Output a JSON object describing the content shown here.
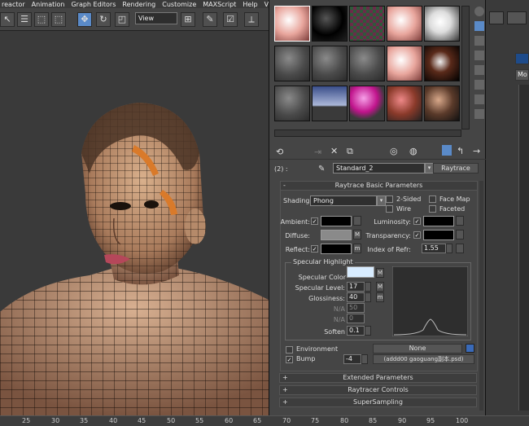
{
  "menu": [
    "reactor",
    "Animation",
    "Graph Editors",
    "Rendering",
    "Customize",
    "MAXScript",
    "Help",
    "Vue"
  ],
  "toolbar": {
    "view_select": "View"
  },
  "material_editor": {
    "level": "(2) :",
    "material_name": "Standard_2",
    "material_type": "Raytrace",
    "rollout_title": "Raytrace Basic Parameters",
    "shading_label": "Shading:",
    "shading_value": "Phong",
    "two_sided": "2-Sided",
    "wire": "Wire",
    "face_map": "Face Map",
    "faceted": "Faceted",
    "ambient": "Ambient:",
    "diffuse": "Diffuse:",
    "reflect": "Reflect:",
    "luminosity": "Luminosity:",
    "transparency": "Transparency:",
    "ior_label": "Index of Refr:",
    "ior_value": "1.55",
    "m": "M",
    "m_lower": "m",
    "specular_group": "Specular Highlight",
    "specular_color": "Specular Color",
    "specular_level": "Specular Level:",
    "specular_level_value": "17",
    "glossiness": "Glossiness:",
    "glossiness_value": "40",
    "na": "N/A",
    "na_value1": "50",
    "na_value2": "0",
    "soften": "Soften",
    "soften_value": "0.1",
    "environment": "Environment",
    "env_map": "None",
    "bump": "Bump",
    "bump_value": "-4",
    "bump_map": "(addd00 gaoguang副本.psd)",
    "rollouts": [
      "Extended Parameters",
      "Raytracer Controls",
      "SuperSampling"
    ],
    "plus": "+",
    "minus": "-"
  },
  "right_panel": {
    "dropdown": "Mo"
  },
  "timeline": [
    "25",
    "30",
    "35",
    "40",
    "45",
    "50",
    "55",
    "60",
    "65",
    "70",
    "75",
    "80",
    "85",
    "90",
    "95",
    "100"
  ],
  "colors": {
    "ambient": "#000000",
    "diffuse": "#8a8a8a",
    "reflect": "#000000",
    "specular": "#d8ecff",
    "luminosity": "#000000",
    "transparency": "#000000"
  }
}
